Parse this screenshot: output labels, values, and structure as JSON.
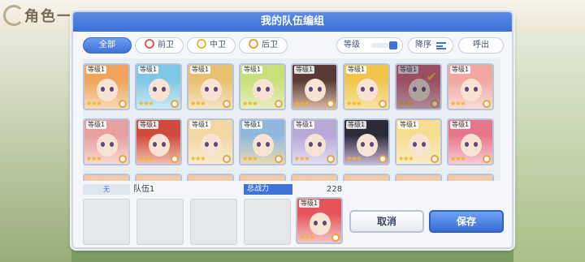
{
  "background": {
    "title": "角色一"
  },
  "dialog": {
    "title": "我的队伍编组",
    "filters": [
      {
        "label": "全部",
        "active": true
      },
      {
        "label": "前卫",
        "active": false
      },
      {
        "label": "中卫",
        "active": false
      },
      {
        "label": "后卫",
        "active": false
      }
    ],
    "sort_field_label": "等级",
    "sort_order_label": "降序",
    "call_label": "呼出"
  },
  "characters": [
    {
      "level": "等级1",
      "stars": "★★★",
      "hair": "#f0a35a",
      "bg": "#f6d9b9",
      "selected": false
    },
    {
      "level": "等级1",
      "stars": "★★★",
      "hair": "#7fc7e6",
      "bg": "#cde9f2",
      "selected": false
    },
    {
      "level": "等级1",
      "stars": "★★★",
      "hair": "#e9c070",
      "bg": "#f3e4c4",
      "selected": false
    },
    {
      "level": "等级1",
      "stars": "★★★",
      "hair": "#c9e07a",
      "bg": "#e5efc3",
      "selected": false
    },
    {
      "level": "等级1",
      "stars": "★★★",
      "hair": "#5a3a35",
      "bg": "#d9b9a5",
      "selected": false
    },
    {
      "level": "等级1",
      "stars": "★★★",
      "hair": "#f0c54a",
      "bg": "#f7e3a6",
      "selected": false
    },
    {
      "level": "等级1",
      "stars": "★★★",
      "hair": "#d9627a",
      "bg": "#f2c0c9",
      "selected": true
    },
    {
      "level": "等级1",
      "stars": "★★★",
      "hair": "#f2a7a1",
      "bg": "#f8dcd7",
      "selected": false
    },
    {
      "level": "等级1",
      "stars": "★★★",
      "hair": "#e89f9f",
      "bg": "#f6d7d2",
      "selected": false
    },
    {
      "level": "等级1",
      "stars": "★★★",
      "hair": "#d04a3c",
      "bg": "#f0bfae",
      "selected": false
    },
    {
      "level": "等级1",
      "stars": "★★★",
      "hair": "#f3d7a0",
      "bg": "#f9ead1",
      "selected": false
    },
    {
      "level": "等级1",
      "stars": "★★★",
      "hair": "#8fb8de",
      "bg": "#e8d9b6",
      "selected": false
    },
    {
      "level": "等级1",
      "stars": "★★★",
      "hair": "#b8a8d8",
      "bg": "#e3dcf1",
      "selected": false
    },
    {
      "level": "等级1",
      "stars": "★★★",
      "hair": "#2b2b3a",
      "bg": "#c9b3d6",
      "selected": false
    },
    {
      "level": "等级1",
      "stars": "★★★",
      "hair": "#f6dd8f",
      "bg": "#f8ecc6",
      "selected": false
    },
    {
      "level": "等级1",
      "stars": "★★★",
      "hair": "#e8768a",
      "bg": "#f6cbd3",
      "selected": false
    }
  ],
  "team": {
    "mark": "无",
    "name": "队伍1",
    "power_label": "总战力",
    "power_value": "228",
    "member": {
      "level": "等级1",
      "stars": "★★★",
      "hair": "#e5545a",
      "bg": "#f3c3c3"
    }
  },
  "buttons": {
    "cancel": "取消",
    "save": "保存"
  }
}
